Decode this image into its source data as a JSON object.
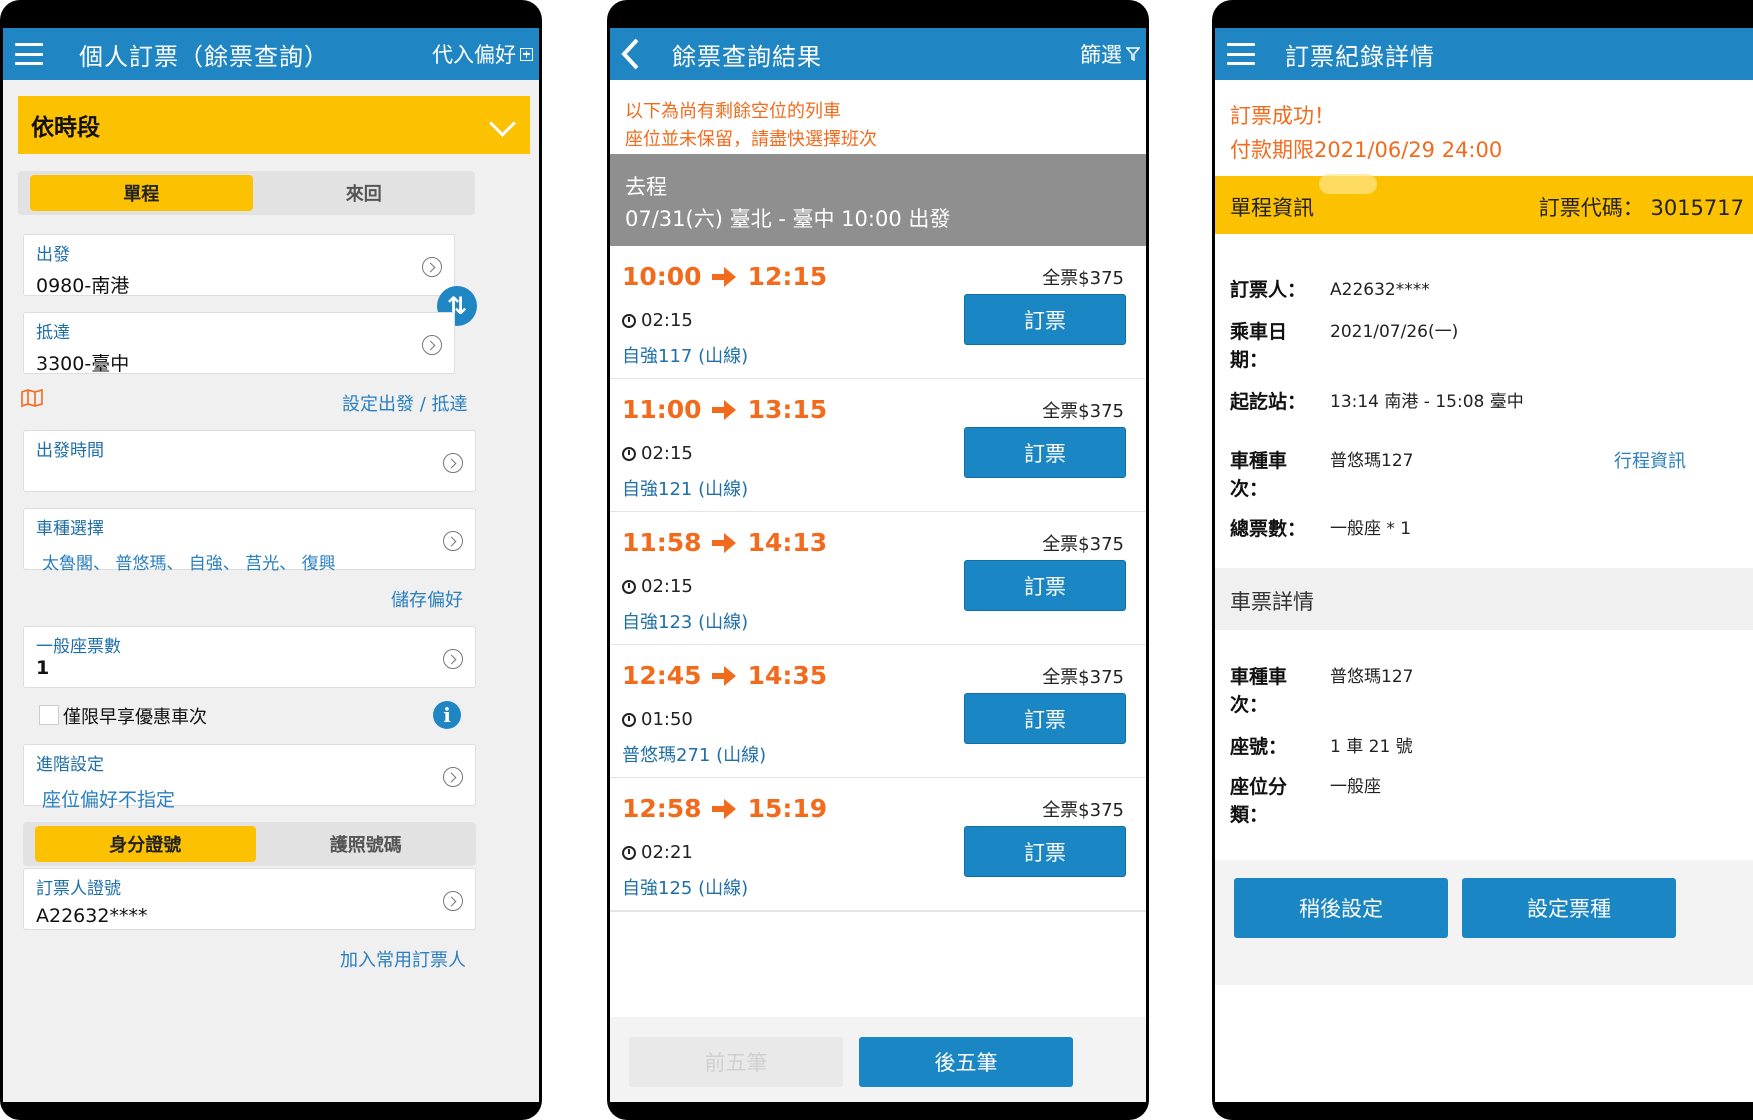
{
  "screen1": {
    "title": "個人訂票（餘票查詢）",
    "right_action": "代入偏好",
    "mode_bar": "依時段",
    "trip_tabs": [
      "單程",
      "來回"
    ],
    "from_label": "出發",
    "from_value": "0980-南港",
    "to_label": "抵達",
    "to_value": "3300-臺中",
    "set_station_link": "設定出發 / 抵達",
    "depart_time_label": "出發時間",
    "depart_time_value": "",
    "train_type_label": "車種選擇",
    "train_type_value": "太魯閣、 普悠瑪、 自強、 莒光、 復興",
    "save_pref_link": "儲存偏好",
    "ticket_count_label": "一般座票數",
    "ticket_count_value": "1",
    "early_bird_label": "僅限早享優惠車次",
    "advanced_label": "進階設定",
    "advanced_value": "座位偏好不指定",
    "id_tabs": [
      "身分證號",
      "護照號碼"
    ],
    "booker_id_label": "訂票人證號",
    "booker_id_value": "A22632****",
    "add_booker_link": "加入常用訂票人"
  },
  "screen2": {
    "title": "餘票查詢結果",
    "filter_label": "篩選",
    "notice_line1": "以下為尚有剩餘空位的列車",
    "notice_line2": "座位並未保留，請盡快選擇班次",
    "trip_direction": "去程",
    "trip_summary": "07/31(六) 臺北 - 臺中 10:00 出發",
    "trains": [
      {
        "depart": "10:00",
        "arrive": "12:15",
        "duration": "02:15",
        "train": "自強117 (山線)",
        "price": "全票$375",
        "book": "訂票"
      },
      {
        "depart": "11:00",
        "arrive": "13:15",
        "duration": "02:15",
        "train": "自強121 (山線)",
        "price": "全票$375",
        "book": "訂票"
      },
      {
        "depart": "11:58",
        "arrive": "14:13",
        "duration": "02:15",
        "train": "自強123 (山線)",
        "price": "全票$375",
        "book": "訂票"
      },
      {
        "depart": "12:45",
        "arrive": "14:35",
        "duration": "01:50",
        "train": "普悠瑪271 (山線)",
        "price": "全票$375",
        "book": "訂票"
      },
      {
        "depart": "12:58",
        "arrive": "15:19",
        "duration": "02:21",
        "train": "自強125 (山線)",
        "price": "全票$375",
        "book": "訂票"
      }
    ],
    "prev_label": "前五筆",
    "next_label": "後五筆"
  },
  "screen3": {
    "title": "訂票紀錄詳情",
    "success_line1": "訂票成功！",
    "success_line2": "付款期限2021/06/29 24:00",
    "section1_title": "單程資訊",
    "booking_code": "訂票代碼： 3015717",
    "booker_key": "訂票人：",
    "booker_val": "A22632****",
    "date_key": "乘車日期：",
    "date_val": "2021/07/26(一)",
    "route_key": "起訖站：",
    "route_val": "13:14 南港 - 15:08 臺中",
    "train_key": "車種車次：",
    "train_val": "普悠瑪127",
    "trip_info_link": "行程資訊",
    "total_key": "總票數：",
    "total_val": "一般座 * 1",
    "section2_title": "車票詳情",
    "d_train_key": "車種車次：",
    "d_train_val": "普悠瑪127",
    "seat_key": "座號：",
    "seat_val": "1 車 21 號",
    "seat_class_key": "座位分類：",
    "seat_class_val": "一般座",
    "later_btn": "稍後設定",
    "set_type_btn": "設定票種"
  },
  "colors": {
    "app_blue": "#1f86c3",
    "accent_yellow": "#fcc100",
    "time_orange": "#f26b1d",
    "link_blue": "#2a7fc0"
  }
}
